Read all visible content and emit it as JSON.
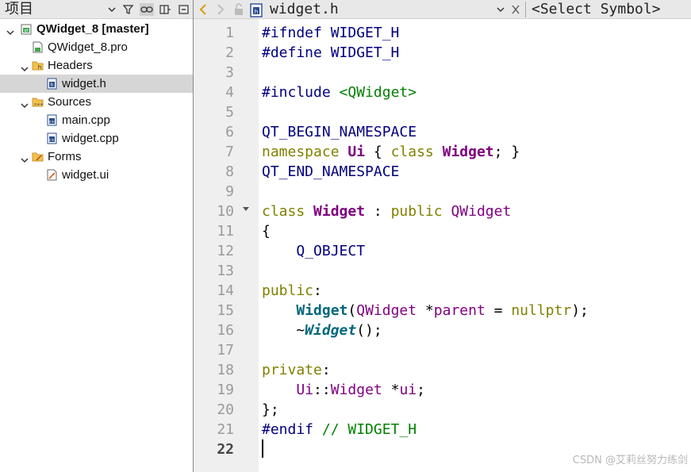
{
  "project_panel": {
    "title": "项目",
    "tree": [
      {
        "label": "QWidget_8 [master]",
        "depth": 0,
        "expanded": true,
        "bold": true,
        "icon": "project-icon",
        "selected": false
      },
      {
        "label": "QWidget_8.pro",
        "depth": 1,
        "icon": "pro-file-icon",
        "selected": false
      },
      {
        "label": "Headers",
        "depth": 1,
        "expanded": true,
        "icon": "headers-folder-icon",
        "selected": false
      },
      {
        "label": "widget.h",
        "depth": 2,
        "icon": "header-file-icon",
        "selected": true
      },
      {
        "label": "Sources",
        "depth": 1,
        "expanded": true,
        "icon": "sources-folder-icon",
        "selected": false
      },
      {
        "label": "main.cpp",
        "depth": 2,
        "icon": "cpp-file-icon",
        "selected": false
      },
      {
        "label": "widget.cpp",
        "depth": 2,
        "icon": "cpp-file-icon",
        "selected": false
      },
      {
        "label": "Forms",
        "depth": 1,
        "expanded": true,
        "icon": "forms-folder-icon",
        "selected": false
      },
      {
        "label": "widget.ui",
        "depth": 2,
        "icon": "ui-file-icon",
        "selected": false
      }
    ]
  },
  "editor": {
    "file_name": "widget.h",
    "symbol_selector": "<Select Symbol>",
    "current_line": 22,
    "lines": [
      [
        [
          "#ifndef WIDGET_H",
          "pp"
        ]
      ],
      [
        [
          "#define WIDGET_H",
          "pp"
        ]
      ],
      [],
      [
        [
          "#include ",
          "pp"
        ],
        [
          "<QWidget>",
          "inc"
        ]
      ],
      [],
      [
        [
          "QT_BEGIN_NAMESPACE",
          "mac"
        ]
      ],
      [
        [
          "namespace ",
          "kw"
        ],
        [
          "Ui",
          "cls"
        ],
        [
          " { ",
          ""
        ],
        [
          "class ",
          "kw"
        ],
        [
          "Widget",
          "cls"
        ],
        [
          "; }",
          ""
        ]
      ],
      [
        [
          "QT_END_NAMESPACE",
          "mac"
        ]
      ],
      [],
      [
        [
          "class ",
          "kw"
        ],
        [
          "Widget",
          "cls"
        ],
        [
          " : ",
          ""
        ],
        [
          "public ",
          "kw"
        ],
        [
          "QWidget",
          "typ"
        ]
      ],
      [
        [
          "{",
          ""
        ]
      ],
      [
        [
          "    ",
          ""
        ],
        [
          "Q_OBJECT",
          "mac"
        ]
      ],
      [],
      [
        [
          "public",
          "kw"
        ],
        [
          ":",
          ""
        ]
      ],
      [
        [
          "    ",
          ""
        ],
        [
          "Widget",
          "fn"
        ],
        [
          "(",
          ""
        ],
        [
          "QWidget",
          "typ"
        ],
        [
          " *",
          ""
        ],
        [
          "parent",
          "nm"
        ],
        [
          " = ",
          ""
        ],
        [
          "nullptr",
          "kw"
        ],
        [
          ");",
          ""
        ]
      ],
      [
        [
          "    ~",
          ""
        ],
        [
          "Widget",
          "fni"
        ],
        [
          "();",
          ""
        ]
      ],
      [],
      [
        [
          "private",
          "kw"
        ],
        [
          ":",
          ""
        ]
      ],
      [
        [
          "    ",
          ""
        ],
        [
          "Ui",
          "typ"
        ],
        [
          "::",
          ""
        ],
        [
          "Widget",
          "typ"
        ],
        [
          " *",
          ""
        ],
        [
          "ui",
          "nm"
        ],
        [
          ";",
          ""
        ]
      ],
      [
        [
          "};",
          ""
        ]
      ],
      [
        [
          "#endif ",
          "pp"
        ],
        [
          "// WIDGET_H",
          "cm"
        ]
      ],
      []
    ]
  },
  "watermark": "CSDN @艾莉丝努力练剑"
}
